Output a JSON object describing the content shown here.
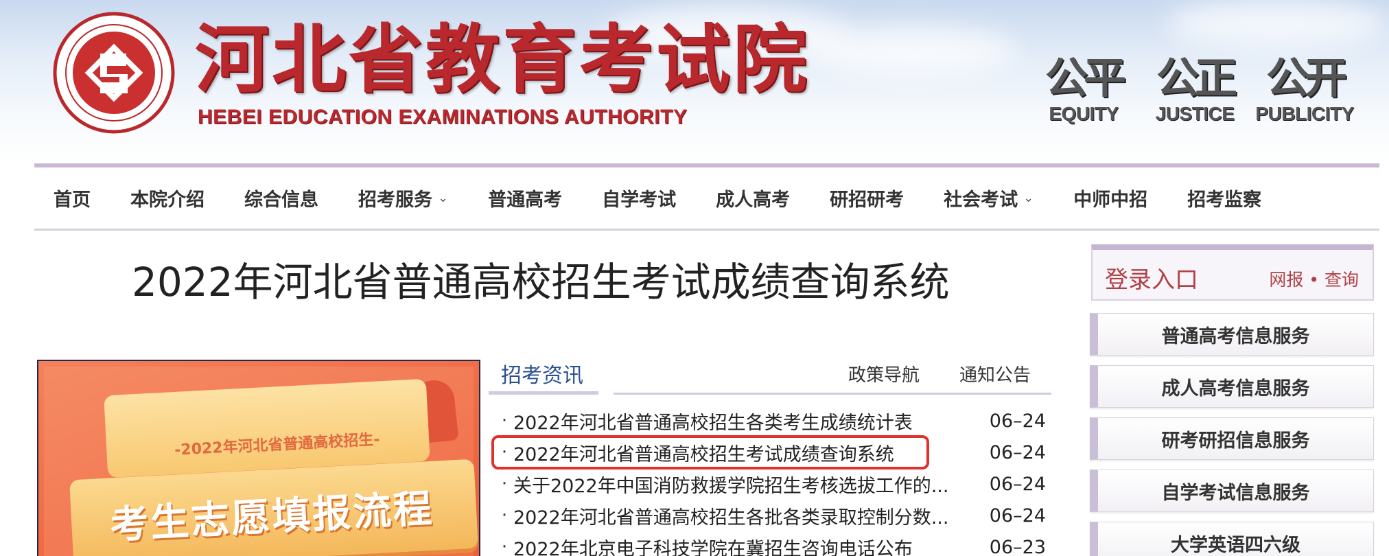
{
  "header": {
    "title_cn": "河北省教育考试院",
    "title_en": "HEBEI EDUCATION EXAMINATIONS AUTHORITY",
    "motto": [
      {
        "cn": "公平",
        "en": "EQUITY"
      },
      {
        "cn": "公正",
        "en": "JUSTICE"
      },
      {
        "cn": "公开",
        "en": "PUBLICITY"
      }
    ],
    "brand_color": "#b8282c"
  },
  "nav": {
    "items": [
      {
        "label": "首页"
      },
      {
        "label": "本院介绍"
      },
      {
        "label": "综合信息"
      },
      {
        "label": "招考服务",
        "has_dropdown": true
      },
      {
        "label": "普通高考"
      },
      {
        "label": "自学考试"
      },
      {
        "label": "成人高考"
      },
      {
        "label": "研招研考"
      },
      {
        "label": "社会考试",
        "has_dropdown": true
      },
      {
        "label": "中师中招"
      },
      {
        "label": "招考监察"
      }
    ]
  },
  "main": {
    "page_title": "2022年河北省普通高校招生考试成绩查询系统",
    "banner": {
      "subtitle": "-2022年河北省普通高校招生-",
      "title": "考生志愿填报流程"
    },
    "news": {
      "tabs": {
        "active": "招考资讯",
        "policy": "政策导航",
        "notice": "通知公告"
      },
      "bullet": "·",
      "items": [
        {
          "title": "2022年河北省普通高校招生各类考生成绩统计表",
          "date": "06–24"
        },
        {
          "title": "2022年河北省普通高校招生考试成绩查询系统",
          "date": "06–24",
          "highlighted": true
        },
        {
          "title": "关于2022年中国消防救援学院招生考核选拔工作的...",
          "date": "06–24"
        },
        {
          "title": "2022年河北省普通高校招生各批各类录取控制分数...",
          "date": "06–24"
        },
        {
          "title": "2022年北京电子科技学院在冀招生咨询电话公布",
          "date": "06–23"
        }
      ]
    }
  },
  "sidebar": {
    "login_title": "登录入口",
    "login_links": "网报 • 查询",
    "buttons": [
      {
        "label": "普通高考信息服务"
      },
      {
        "label": "成人高考信息服务"
      },
      {
        "label": "研考研招信息服务"
      },
      {
        "label": "自学考试信息服务"
      },
      {
        "label": "大学英语四六级"
      }
    ]
  }
}
